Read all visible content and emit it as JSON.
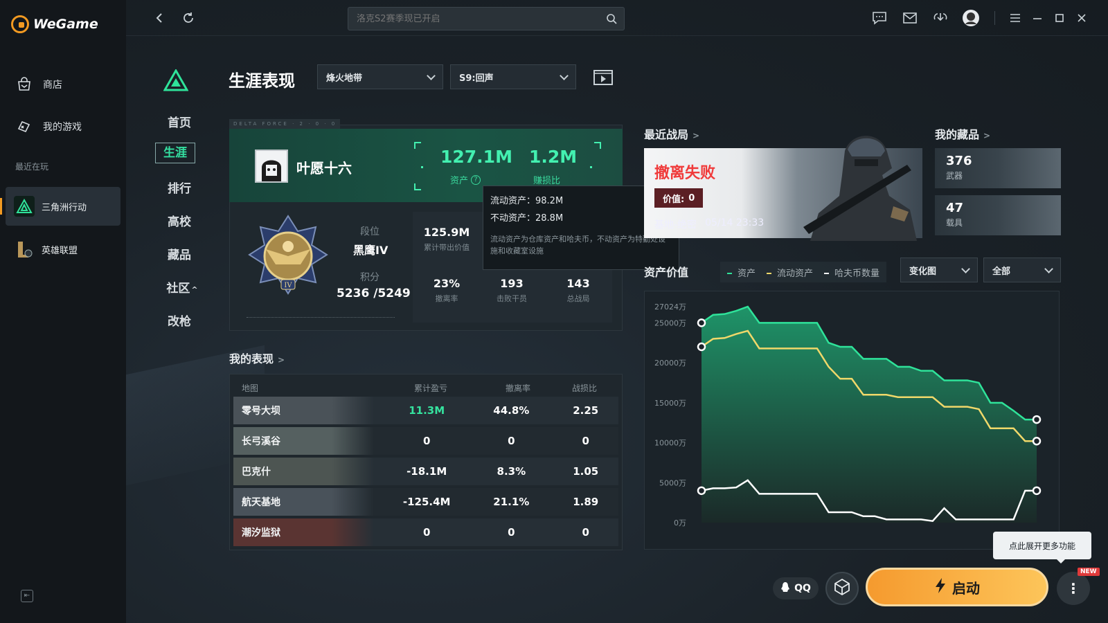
{
  "app": {
    "name": "WeGame"
  },
  "sidebar": {
    "items": [
      {
        "label": "商店",
        "icon": "store-icon"
      },
      {
        "label": "我的游戏",
        "icon": "gamepad-icon"
      }
    ],
    "recent_label": "最近在玩",
    "games": [
      {
        "label": "三角洲行动",
        "active": true
      },
      {
        "label": "英雄联盟",
        "active": false
      }
    ]
  },
  "topbar": {
    "search_placeholder": "洛克S2赛季现已开启"
  },
  "game_nav": {
    "items": [
      "首页",
      "生涯",
      "排行",
      "高校",
      "藏品",
      "社区",
      "改枪"
    ],
    "active": "生涯"
  },
  "header": {
    "title": "生涯表现",
    "mode_select": "烽火地带",
    "season_select": "S9:回声"
  },
  "profile": {
    "card_tag": "DELTA FORCE · 2 · 0 · 0 · 5",
    "player_name": "叶愿十六",
    "assets_value": "127.1M",
    "assets_label": "资产",
    "ratio_value": "1.2M",
    "ratio_label": "赚损比",
    "rank_label": "段位",
    "rank_value": "黑鹰IV",
    "points_label": "积分",
    "points_value": "5236 /5249",
    "stats": [
      {
        "value": "125.9M",
        "label": "累计带出价值"
      },
      {
        "value": "23%",
        "label": "撤离率"
      },
      {
        "value": "193",
        "label": "击败干员"
      },
      {
        "value": "143",
        "label": "总战局"
      }
    ]
  },
  "tooltip": {
    "line1": "流动资产：98.2M",
    "line2": "不动资产：28.8M",
    "note": "流动资产为仓库资产和哈夫币，不动资产为特勤处设施和收藏室设施"
  },
  "performance": {
    "title": "我的表现",
    "headers": [
      "地图",
      "累计盈亏",
      "撤离率",
      "战损比"
    ],
    "rows": [
      {
        "map": "零号大坝",
        "profit": "11.3M",
        "rate": "44.8%",
        "kd": "2.25",
        "bg": "#4a5258"
      },
      {
        "map": "长弓溪谷",
        "profit": "0",
        "rate": "0",
        "kd": "0",
        "bg": "#556060"
      },
      {
        "map": "巴克什",
        "profit": "-18.1M",
        "rate": "8.3%",
        "kd": "1.05",
        "bg": "#4d5552"
      },
      {
        "map": "航天基地",
        "profit": "-125.4M",
        "rate": "21.1%",
        "kd": "1.89",
        "bg": "#49525a"
      },
      {
        "map": "潮汐监狱",
        "profit": "0",
        "rate": "0",
        "kd": "0",
        "bg": "#5a3432"
      }
    ]
  },
  "recent_match": {
    "title": "最近战局",
    "result": "撤离失败",
    "value_label": "价值:",
    "value": "0",
    "map": "基地-绝密",
    "time": "05/14 23:33"
  },
  "collection": {
    "title": "我的藏品",
    "items": [
      {
        "count": "376",
        "label": "武器"
      },
      {
        "count": "47",
        "label": "载具"
      }
    ]
  },
  "asset_chart": {
    "title": "资产价值",
    "legend": [
      {
        "label": "资产",
        "color": "#2fe39a"
      },
      {
        "label": "流动资产",
        "color": "#f0d86a"
      },
      {
        "label": "哈夫币数量",
        "color": "#ffffff"
      }
    ],
    "view_select": "变化图",
    "range_select": "全部"
  },
  "chart_data": {
    "type": "area",
    "title": "资产价值",
    "y_ticks": [
      "27024万",
      "25000万",
      "20000万",
      "15000万",
      "10000万",
      "5000万",
      "0万"
    ],
    "ylim": [
      0,
      27024
    ],
    "series": [
      {
        "name": "资产",
        "color": "#2fe39a",
        "values": [
          25000,
          26000,
          26100,
          26500,
          27024,
          25000,
          25000,
          25000,
          25000,
          25000,
          25000,
          22500,
          22000,
          22000,
          20500,
          20500,
          20500,
          19500,
          19500,
          19000,
          19000,
          17800,
          17800,
          17800,
          17500,
          15000,
          15000,
          14000,
          12900,
          12900
        ]
      },
      {
        "name": "流动资产",
        "color": "#f0d86a",
        "values": [
          22000,
          23000,
          23100,
          23600,
          24000,
          21800,
          21800,
          21800,
          21800,
          21800,
          21800,
          19500,
          18000,
          18000,
          16000,
          16000,
          16000,
          15700,
          15700,
          15700,
          15700,
          14500,
          14500,
          14500,
          14200,
          11800,
          11800,
          11800,
          10200,
          10200
        ]
      },
      {
        "name": "哈夫币数量",
        "color": "#ffffff",
        "values": [
          4000,
          4300,
          4300,
          4400,
          5300,
          3600,
          3600,
          3600,
          3600,
          3600,
          3600,
          1300,
          1300,
          1300,
          800,
          800,
          400,
          400,
          400,
          400,
          200,
          1800,
          400,
          400,
          400,
          400,
          400,
          400,
          4000,
          4000
        ]
      }
    ]
  },
  "bottom": {
    "qq_label": "QQ",
    "launch_label": "启动",
    "new_badge": "NEW",
    "hint": "点此展开更多功能"
  }
}
